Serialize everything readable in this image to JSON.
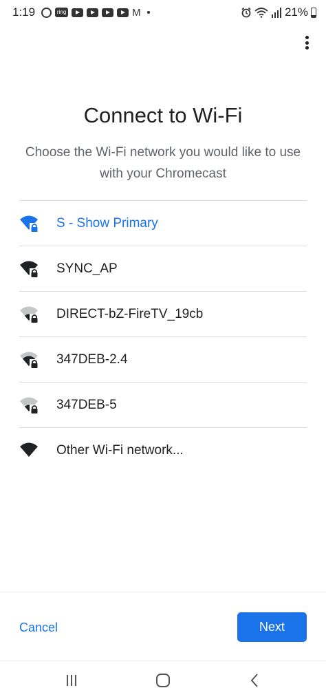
{
  "status_bar": {
    "time": "1:19",
    "ring_label": "ring",
    "battery": "21%",
    "notification_icons": [
      "messenger-icon",
      "ring-icon",
      "youtube-icon",
      "youtube-icon",
      "youtube-icon",
      "youtube-icon",
      "gmail-icon"
    ],
    "system_icons": [
      "alarm-icon",
      "wifi-icon",
      "cellular-signal-icon",
      "battery-icon"
    ]
  },
  "header": {
    "title": "Connect to Wi-Fi",
    "subtitle": "Choose the Wi-Fi network you would like to use with your Chromecast"
  },
  "networks": [
    {
      "name": "S - Show Primary",
      "signal": "full",
      "locked": true,
      "selected": true
    },
    {
      "name": "SYNC_AP",
      "signal": "full",
      "locked": true,
      "selected": false
    },
    {
      "name": "DIRECT-bZ-FireTV_19cb",
      "signal": "weak",
      "locked": true,
      "selected": false
    },
    {
      "name": "347DEB-2.4",
      "signal": "medium",
      "locked": true,
      "selected": false
    },
    {
      "name": "347DEB-5",
      "signal": "weak",
      "locked": true,
      "selected": false
    },
    {
      "name": "Other Wi-Fi network...",
      "signal": "full",
      "locked": false,
      "selected": false
    }
  ],
  "footer": {
    "cancel_label": "Cancel",
    "next_label": "Next"
  },
  "colors": {
    "accent": "#1a73e8",
    "text": "#202124",
    "secondary_text": "#5f6368",
    "divider": "#dadce0"
  }
}
